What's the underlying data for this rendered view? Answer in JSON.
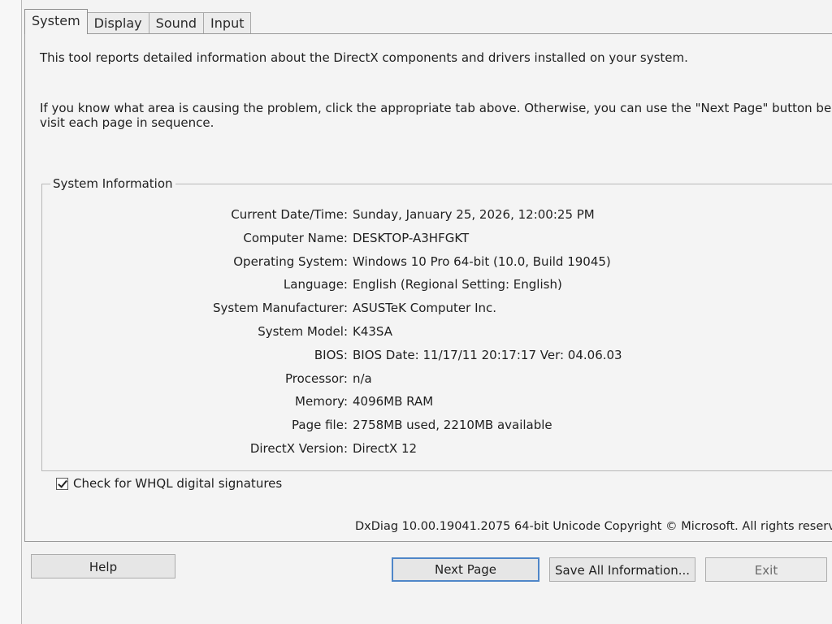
{
  "tabs": [
    "System",
    "Display",
    "Sound",
    "Input"
  ],
  "intro_line": "This tool reports detailed information about the DirectX components and drivers installed on your system.",
  "help_line1": "If you know what area is causing the problem, click the appropriate tab above.  Otherwise, you can use the \"Next Page\" button below to",
  "help_line2": "visit each page in sequence.",
  "system_info": {
    "legend": "System Information",
    "rows": [
      {
        "label": "Current Date/Time:",
        "value": "Sunday, January 25, 2026, 12:00:25 PM"
      },
      {
        "label": "Computer Name:",
        "value": "DESKTOP-A3HFGKT"
      },
      {
        "label": "Operating System:",
        "value": "Windows 10 Pro 64-bit (10.0, Build 19045)"
      },
      {
        "label": "Language:",
        "value": "English (Regional Setting: English)"
      },
      {
        "label": "System Manufacturer:",
        "value": "ASUSTeK Computer Inc."
      },
      {
        "label": "System Model:",
        "value": "K43SA"
      },
      {
        "label": "BIOS:",
        "value": "BIOS Date: 11/17/11 20:17:17 Ver: 04.06.03"
      },
      {
        "label": "Processor:",
        "value": "n/a"
      },
      {
        "label": "Memory:",
        "value": "4096MB RAM"
      },
      {
        "label": "Page file:",
        "value": "2758MB used, 2210MB available"
      },
      {
        "label": "DirectX Version:",
        "value": "DirectX 12"
      }
    ]
  },
  "whql_checkbox": {
    "label": "Check for WHQL digital signatures",
    "checked": true
  },
  "footer": "DxDiag 10.00.19041.2075 64-bit Unicode  Copyright © Microsoft. All rights reserved.",
  "buttons": {
    "help": "Help",
    "next_page": "Next Page",
    "save_all": "Save All Information...",
    "exit": "Exit"
  }
}
